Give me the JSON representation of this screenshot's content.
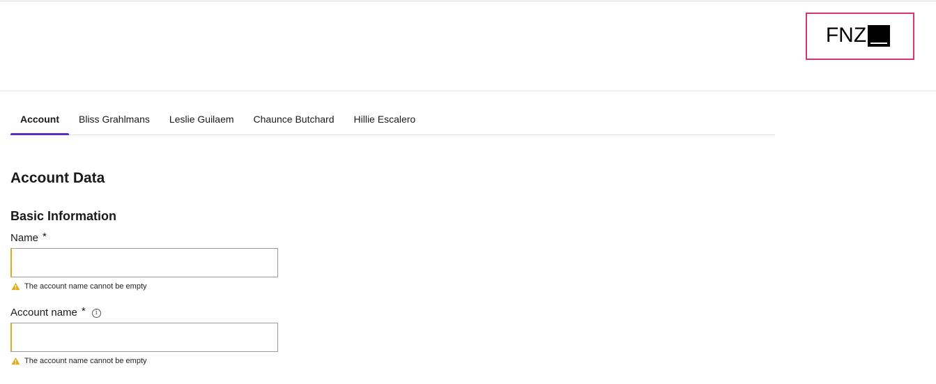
{
  "header": {
    "logo_text": "FNZ"
  },
  "tabs": [
    {
      "label": "Account",
      "active": true
    },
    {
      "label": "Bliss Grahlmans",
      "active": false
    },
    {
      "label": "Leslie Guilaem",
      "active": false
    },
    {
      "label": "Chaunce Butchard",
      "active": false
    },
    {
      "label": "Hillie Escalero",
      "active": false
    }
  ],
  "main": {
    "section_title": "Account Data",
    "subsection_title": "Basic Information",
    "fields": [
      {
        "label": "Name",
        "required_marker": "*",
        "value": "",
        "placeholder": "",
        "warning": "The account name cannot be empty",
        "has_info_icon": false
      },
      {
        "label": "Account name",
        "required_marker": "*",
        "value": "",
        "placeholder": "",
        "warning": "The account name cannot be empty",
        "has_info_icon": true,
        "info_glyph": "i"
      }
    ]
  },
  "colors": {
    "accent_tab": "#5a2dc8",
    "logo_border": "#d4346f",
    "warning": "#e6a817"
  }
}
